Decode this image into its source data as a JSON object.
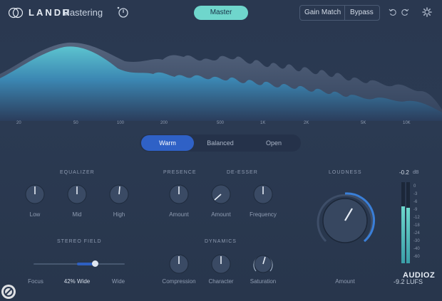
{
  "header": {
    "brand": "LANDR",
    "product": "Mastering",
    "master_label": "Master",
    "gain_match_label": "Gain Match",
    "bypass_label": "Bypass"
  },
  "spectrum": {
    "freq_labels": [
      "20",
      "50",
      "100",
      "200",
      "500",
      "1K",
      "2K",
      "5K",
      "10K"
    ]
  },
  "tone": {
    "options": [
      "Warm",
      "Balanced",
      "Open"
    ],
    "selected": "Warm"
  },
  "equalizer": {
    "title": "EQUALIZER",
    "bands": [
      "Low",
      "Mid",
      "High"
    ]
  },
  "presence": {
    "title": "PRESENCE",
    "amount_label": "Amount"
  },
  "deesser": {
    "title": "DE-ESSER",
    "amount_label": "Amount",
    "frequency_label": "Frequency"
  },
  "stereo": {
    "title": "STEREO FIELD",
    "left_label": "Focus",
    "value_label": "42% Wide",
    "right_label": "Wide",
    "value": 0.42
  },
  "dynamics": {
    "title": "DYNAMICS",
    "labels": [
      "Compression",
      "Character",
      "Saturation"
    ]
  },
  "loudness": {
    "title": "LOUDNESS",
    "amount_label": "Amount",
    "peak_value": "-0.2",
    "peak_unit": "dB",
    "lufs_value": "-9.2 LUFS",
    "meter_ticks": [
      "0",
      "-3",
      "-6",
      "-9",
      "-12",
      "-18",
      "-24",
      "-30",
      "-40",
      "-60"
    ]
  },
  "watermark": {
    "text": "AUDIOZ"
  },
  "colors": {
    "accent_teal": "#6fd6cc",
    "accent_blue": "#2f61c6",
    "background": "#2a3850"
  }
}
